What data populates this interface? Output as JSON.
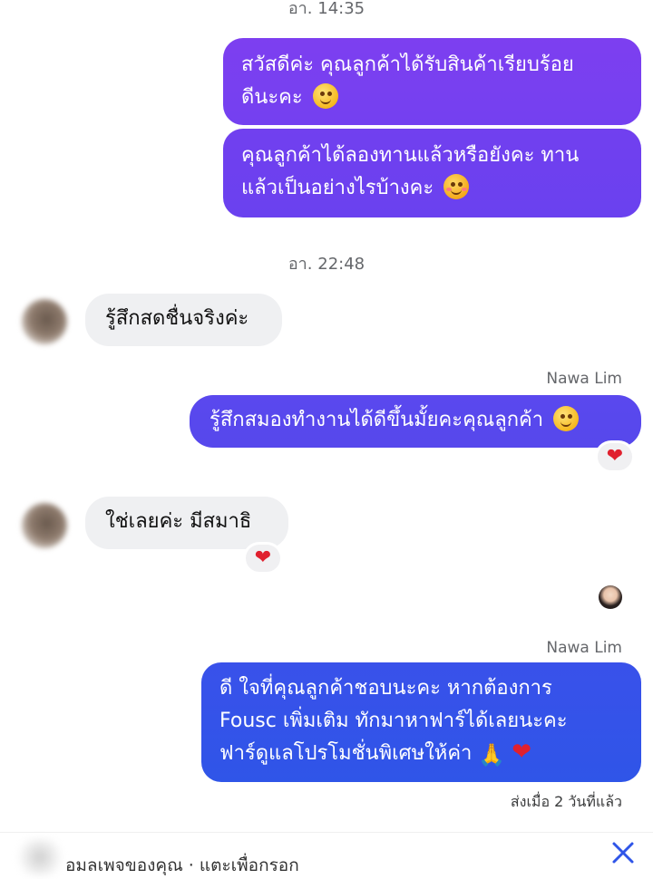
{
  "colors": {
    "outgoing_top": "#7b3fef",
    "outgoing_bottom": "#2f55e8",
    "incoming": "#eff0f2",
    "heart": "#e0202e",
    "timestamp": "#65676b"
  },
  "thread": {
    "timestamp_1": "อา. 14:35",
    "msg_out_1_line1": "สวัสดีค่ะ คุณลูกค้าได้รับสินค้าเรียบร้อย",
    "msg_out_1_line2": "ดีนะคะ",
    "msg_out_2_line1": "คุณลูกค้าได้ลองทานแล้วหรือยังคะ ทาน",
    "msg_out_2_line2": "แล้วเป็นอย่างไรบ้างคะ",
    "timestamp_2": "อา. 22:48",
    "msg_in_1": "รู้สึกสดชื่นจริงค่ะ",
    "sender_1": "Nawa Lim",
    "msg_out_3": "รู้สึกสมองทำงานได้ดีขึ้นมั้ยคะคุณลูกค้า",
    "msg_in_2": "ใช่เลยค่ะ มีสมาธิ",
    "sender_2": "Nawa Lim",
    "msg_out_4_line1": "ดี ใจที่คุณลูกค้าชอบนะคะ หากต้องการ",
    "msg_out_4_line2": "Fousc เพิ่มเติม ทักมาหาฟาร์ได้เลยนะคะ",
    "msg_out_4_line3": "ฟาร์ดูแลโปรโมชั่นพิเศษให้ค่า",
    "sent_status": "ส่งเมื่อ 2 วันที่แล้ว",
    "reaction": "❤"
  },
  "bottom_bar": {
    "text": "อมลเพจของคุณ · แตะเพื่อกรอก"
  },
  "icons": [
    "smiling-face-icon",
    "smiling-face-with-hearts-icon",
    "relieved-face-icon",
    "heart-icon",
    "folded-hands-icon",
    "close-icon"
  ]
}
